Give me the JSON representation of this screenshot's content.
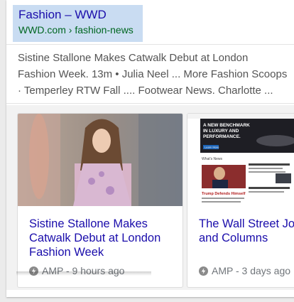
{
  "result": {
    "title": "Fashion – WWD",
    "url": "WWD.com › fashion-news",
    "snippet": "Sistine Stallone Makes Catwalk Debut at London Fashion Week. 13m • Julia Neel ... More Fashion Scoops · Temperley RTW Fall .... Footwear News. Charlotte ..."
  },
  "cards": [
    {
      "headline": "Sistine Stallone Makes Catwalk Debut at London Fashion Week",
      "meta": "AMP - 9 hours ago",
      "amp_icon": "amp-bolt-icon"
    },
    {
      "headline": "The Wall Street Journal Nixes Fashion and Columns",
      "meta": "AMP - 3 days ago",
      "amp_icon": "amp-bolt-icon"
    }
  ],
  "thumb2": {
    "ad_text": "A NEW BENCHMARK IN LUXURY AND PERFORMANCE.",
    "ad_button": "Learn More",
    "headline_text": "Trump Defends Himself",
    "section": "What's News"
  },
  "colors": {
    "link": "#1a0dab",
    "url_green": "#006621",
    "header_highlight": "#c9dcf2"
  }
}
